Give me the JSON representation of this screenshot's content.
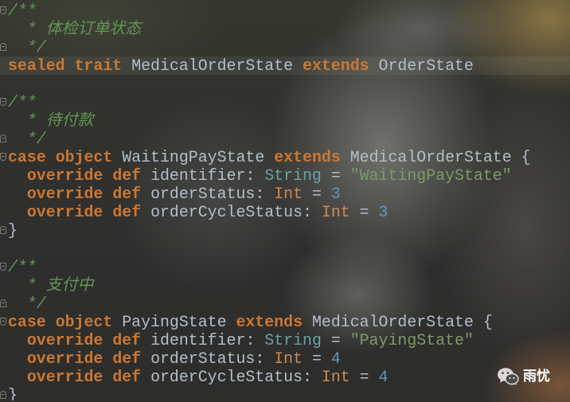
{
  "colors": {
    "doc": "#629755",
    "keyword": "#cc7832",
    "ident": "#b4bfca",
    "plain": "#b4bfca",
    "type_alias": "#6aa3a3",
    "class": "#d08b4f",
    "string": "#7e9a6a",
    "number": "#6897bb"
  },
  "editor": {
    "caret_line": 4,
    "lines": [
      {
        "fold": "fold-start-icon",
        "tokens": [
          {
            "t": "doc",
            "v": "/**"
          }
        ]
      },
      {
        "tokens": [
          {
            "t": "doc",
            "v": "  * 体检订单状态"
          }
        ]
      },
      {
        "fold": "fold-end-icon",
        "tokens": [
          {
            "t": "doc",
            "v": "  */"
          }
        ]
      },
      {
        "tokens": [
          {
            "t": "keyword",
            "v": "sealed"
          },
          {
            "t": "plain",
            "v": " "
          },
          {
            "t": "keyword",
            "v": "trait"
          },
          {
            "t": "plain",
            "v": " "
          },
          {
            "t": "ident",
            "v": "MedicalOrderState"
          },
          {
            "t": "plain",
            "v": " "
          },
          {
            "t": "keyword",
            "v": "extends"
          },
          {
            "t": "plain",
            "v": " "
          },
          {
            "t": "ident",
            "v": "OrderState"
          }
        ]
      },
      {
        "tokens": []
      },
      {
        "fold": "fold-start-icon",
        "tokens": [
          {
            "t": "doc",
            "v": "/**"
          }
        ]
      },
      {
        "tokens": [
          {
            "t": "doc",
            "v": "  * 待付款"
          }
        ]
      },
      {
        "fold": "fold-end-icon",
        "tokens": [
          {
            "t": "doc",
            "v": "  */"
          }
        ]
      },
      {
        "fold": "fold-start-icon",
        "tokens": [
          {
            "t": "keyword",
            "v": "case"
          },
          {
            "t": "plain",
            "v": " "
          },
          {
            "t": "keyword",
            "v": "object"
          },
          {
            "t": "plain",
            "v": " "
          },
          {
            "t": "ident",
            "v": "WaitingPayState"
          },
          {
            "t": "plain",
            "v": " "
          },
          {
            "t": "keyword",
            "v": "extends"
          },
          {
            "t": "plain",
            "v": " "
          },
          {
            "t": "ident",
            "v": "MedicalOrderState"
          },
          {
            "t": "plain",
            "v": " {"
          }
        ]
      },
      {
        "tokens": [
          {
            "t": "plain",
            "v": "  "
          },
          {
            "t": "keyword",
            "v": "override"
          },
          {
            "t": "plain",
            "v": " "
          },
          {
            "t": "keyword",
            "v": "def"
          },
          {
            "t": "plain",
            "v": " "
          },
          {
            "t": "ident",
            "v": "identifier"
          },
          {
            "t": "plain",
            "v": ": "
          },
          {
            "t": "type_alias",
            "v": "String"
          },
          {
            "t": "plain",
            "v": " = "
          },
          {
            "t": "string",
            "v": "\"WaitingPayState\""
          }
        ]
      },
      {
        "tokens": [
          {
            "t": "plain",
            "v": "  "
          },
          {
            "t": "keyword",
            "v": "override"
          },
          {
            "t": "plain",
            "v": " "
          },
          {
            "t": "keyword",
            "v": "def"
          },
          {
            "t": "plain",
            "v": " "
          },
          {
            "t": "ident",
            "v": "orderStatus"
          },
          {
            "t": "plain",
            "v": ": "
          },
          {
            "t": "class",
            "v": "Int"
          },
          {
            "t": "plain",
            "v": " = "
          },
          {
            "t": "number",
            "v": "3"
          }
        ]
      },
      {
        "tokens": [
          {
            "t": "plain",
            "v": "  "
          },
          {
            "t": "keyword",
            "v": "override"
          },
          {
            "t": "plain",
            "v": " "
          },
          {
            "t": "keyword",
            "v": "def"
          },
          {
            "t": "plain",
            "v": " "
          },
          {
            "t": "ident",
            "v": "orderCycleStatus"
          },
          {
            "t": "plain",
            "v": ": "
          },
          {
            "t": "class",
            "v": "Int"
          },
          {
            "t": "plain",
            "v": " = "
          },
          {
            "t": "number",
            "v": "3"
          }
        ]
      },
      {
        "fold": "fold-end-icon",
        "tokens": [
          {
            "t": "plain",
            "v": "}"
          }
        ]
      },
      {
        "tokens": []
      },
      {
        "fold": "fold-start-icon",
        "tokens": [
          {
            "t": "doc",
            "v": "/**"
          }
        ]
      },
      {
        "tokens": [
          {
            "t": "doc",
            "v": "  * 支付中"
          }
        ]
      },
      {
        "fold": "fold-end-icon",
        "tokens": [
          {
            "t": "doc",
            "v": "  */"
          }
        ]
      },
      {
        "fold": "fold-start-icon",
        "tokens": [
          {
            "t": "keyword",
            "v": "case"
          },
          {
            "t": "plain",
            "v": " "
          },
          {
            "t": "keyword",
            "v": "object"
          },
          {
            "t": "plain",
            "v": " "
          },
          {
            "t": "ident",
            "v": "PayingState"
          },
          {
            "t": "plain",
            "v": " "
          },
          {
            "t": "keyword",
            "v": "extends"
          },
          {
            "t": "plain",
            "v": " "
          },
          {
            "t": "ident",
            "v": "MedicalOrderState"
          },
          {
            "t": "plain",
            "v": " {"
          }
        ]
      },
      {
        "tokens": [
          {
            "t": "plain",
            "v": "  "
          },
          {
            "t": "keyword",
            "v": "override"
          },
          {
            "t": "plain",
            "v": " "
          },
          {
            "t": "keyword",
            "v": "def"
          },
          {
            "t": "plain",
            "v": " "
          },
          {
            "t": "ident",
            "v": "identifier"
          },
          {
            "t": "plain",
            "v": ": "
          },
          {
            "t": "type_alias",
            "v": "String"
          },
          {
            "t": "plain",
            "v": " = "
          },
          {
            "t": "string",
            "v": "\"PayingState\""
          }
        ]
      },
      {
        "tokens": [
          {
            "t": "plain",
            "v": "  "
          },
          {
            "t": "keyword",
            "v": "override"
          },
          {
            "t": "plain",
            "v": " "
          },
          {
            "t": "keyword",
            "v": "def"
          },
          {
            "t": "plain",
            "v": " "
          },
          {
            "t": "ident",
            "v": "orderStatus"
          },
          {
            "t": "plain",
            "v": ": "
          },
          {
            "t": "class",
            "v": "Int"
          },
          {
            "t": "plain",
            "v": " = "
          },
          {
            "t": "number",
            "v": "4"
          }
        ]
      },
      {
        "tokens": [
          {
            "t": "plain",
            "v": "  "
          },
          {
            "t": "keyword",
            "v": "override"
          },
          {
            "t": "plain",
            "v": " "
          },
          {
            "t": "keyword",
            "v": "def"
          },
          {
            "t": "plain",
            "v": " "
          },
          {
            "t": "ident",
            "v": "orderCycleStatus"
          },
          {
            "t": "plain",
            "v": ": "
          },
          {
            "t": "class",
            "v": "Int"
          },
          {
            "t": "plain",
            "v": " = "
          },
          {
            "t": "number",
            "v": "4"
          }
        ]
      },
      {
        "fold": "fold-end-icon",
        "tokens": [
          {
            "t": "plain",
            "v": "}"
          }
        ]
      }
    ]
  },
  "watermark": {
    "icon": "wechat-icon",
    "text": "雨忧"
  }
}
